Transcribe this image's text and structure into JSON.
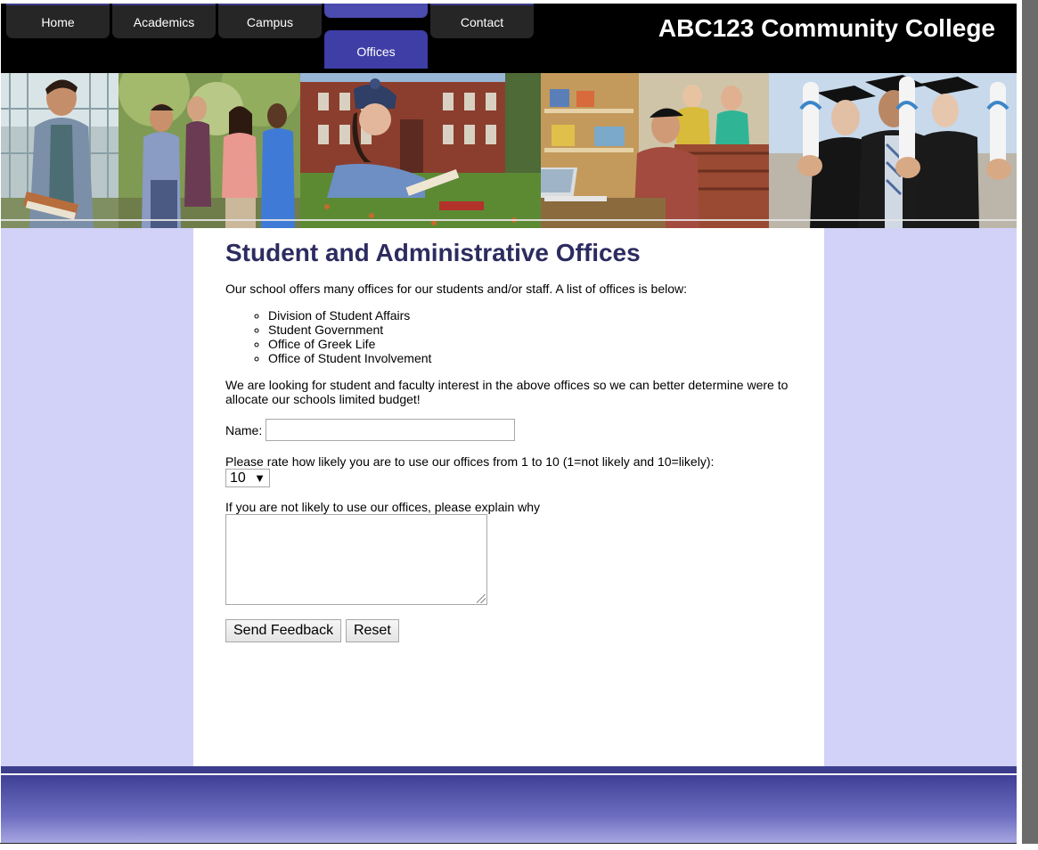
{
  "nav": {
    "items": [
      {
        "label": "Home"
      },
      {
        "label": "Academics"
      },
      {
        "label": "Campus"
      },
      {
        "label": "Offices"
      },
      {
        "label": "Contact"
      }
    ],
    "active": "Offices"
  },
  "site": {
    "title": "ABC123 Community College"
  },
  "colors": {
    "background": "#d2d2f8",
    "header": "#000000",
    "heading": "#2c2c60",
    "active_tab": "#3e3ea6",
    "footer_band": "#3d3d8e"
  },
  "main": {
    "heading": "Student and Administrative Offices",
    "intro": "Our school offers many offices for our students and/or staff. A list of offices is below:",
    "offices": [
      "Division of Student Affairs",
      "Student Government",
      "Office of Greek Life",
      "Office of Student Involvement"
    ],
    "interest_text": "We are looking for student and faculty interest in the above offices so we can better determine were to allocate our schools limited budget!"
  },
  "form": {
    "name_label": "Name:",
    "name_value": "",
    "rating_label": "Please rate how likely you are to use our offices from 1 to 10 (1=not likely and 10=likely):",
    "rating_value": "10",
    "explain_label": "If you are not likely to use our offices, please explain why",
    "explain_value": "",
    "submit_label": "Send Feedback",
    "reset_label": "Reset"
  }
}
